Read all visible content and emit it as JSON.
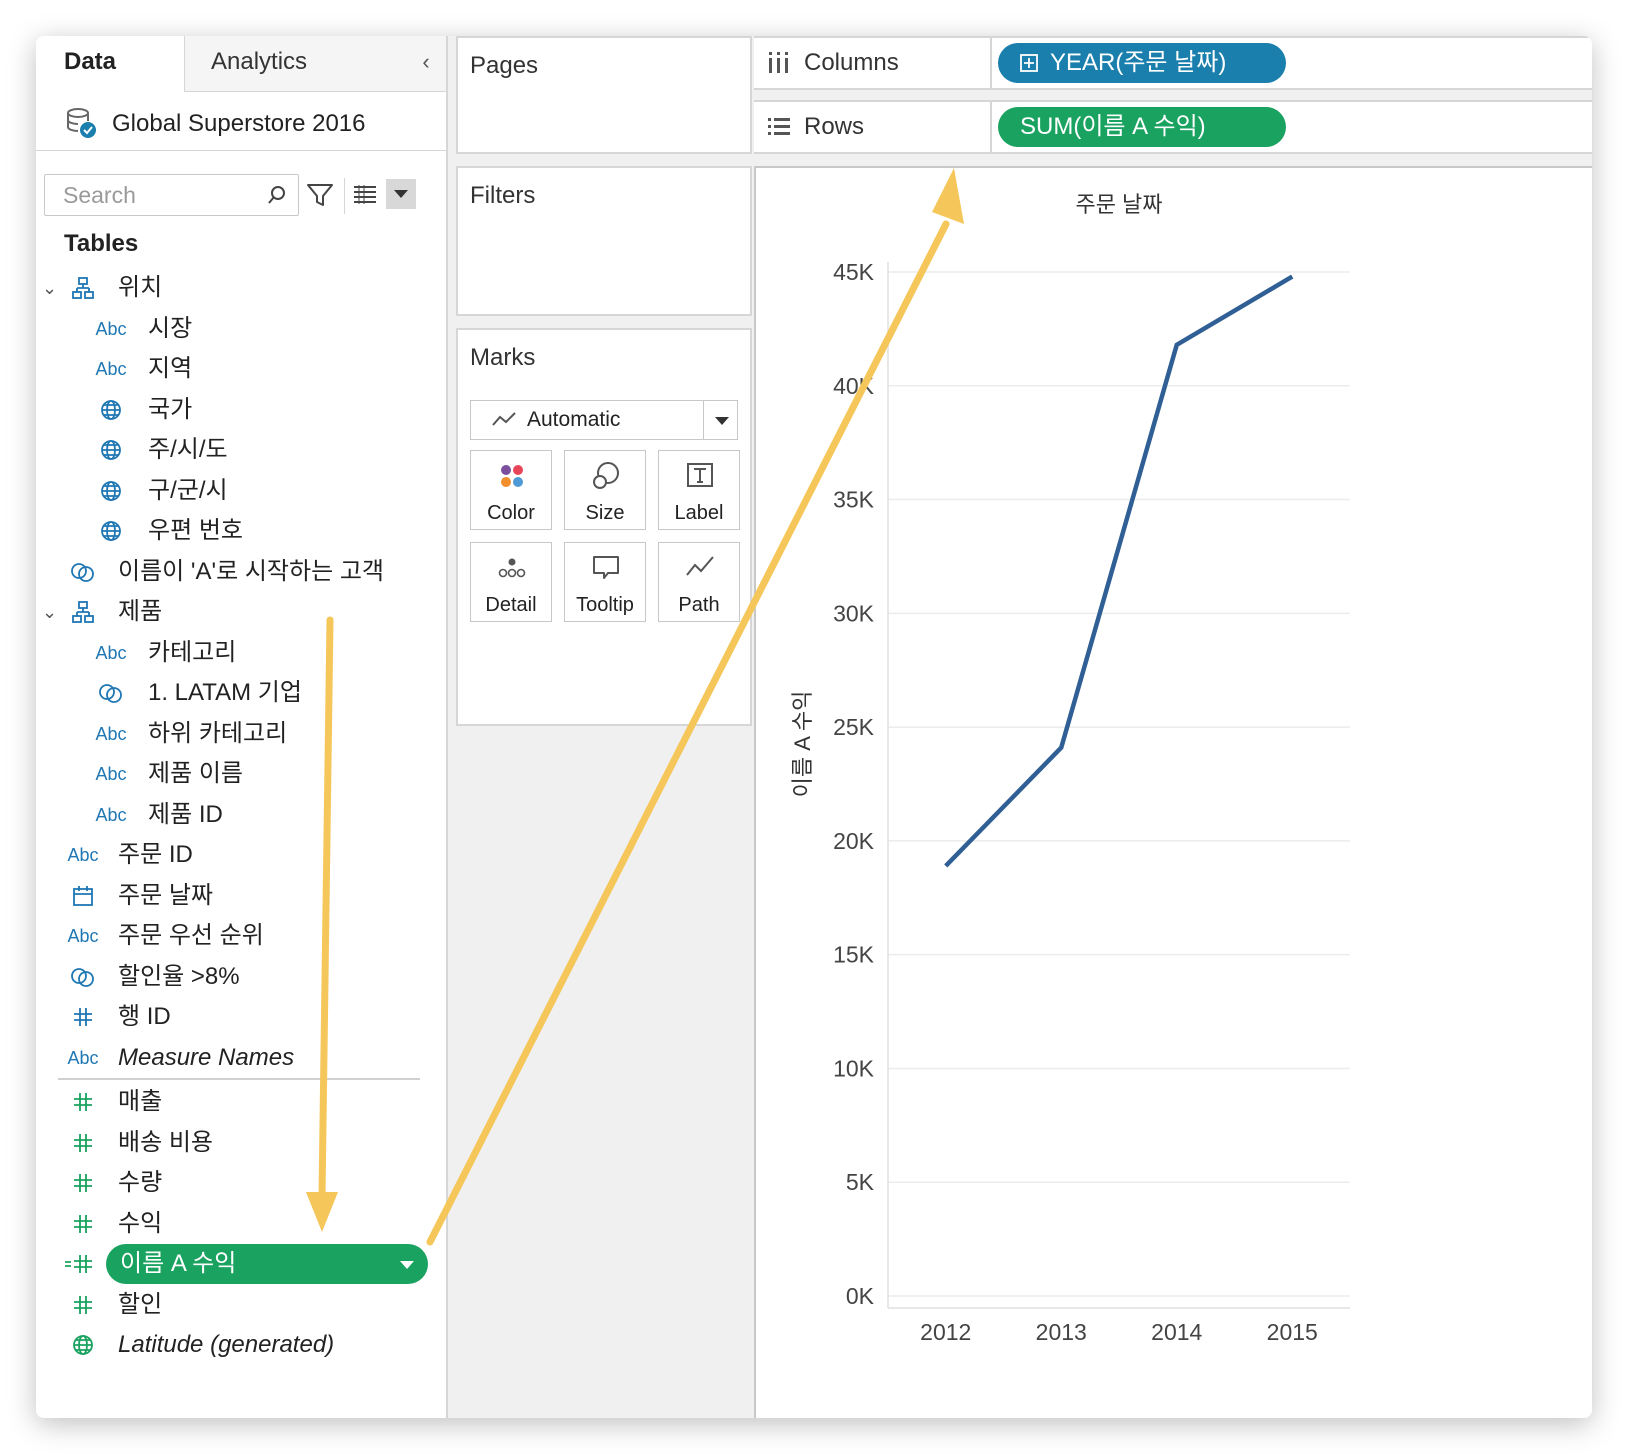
{
  "data_pane": {
    "tabs": [
      "Data",
      "Analytics"
    ],
    "datasource": "Global Superstore 2016",
    "search_placeholder": "Search",
    "tables_header": "Tables",
    "fields": [
      {
        "label": "위치",
        "icon": "hierarchy-icon",
        "level": 0,
        "expandable": true
      },
      {
        "label": "시장",
        "icon": "Abc",
        "level": 1
      },
      {
        "label": "지역",
        "icon": "Abc",
        "level": 1
      },
      {
        "label": "국가",
        "icon": "globe-icon",
        "level": 1
      },
      {
        "label": "주/시/도",
        "icon": "globe-icon",
        "level": 1
      },
      {
        "label": "구/군/시",
        "icon": "globe-icon",
        "level": 1
      },
      {
        "label": "우편 번호",
        "icon": "globe-icon",
        "level": 1
      },
      {
        "label": "이름이 'A'로 시작하는 고객",
        "icon": "set-icon",
        "level": 0
      },
      {
        "label": "제품",
        "icon": "hierarchy-icon",
        "level": 0,
        "expandable": true
      },
      {
        "label": "카테고리",
        "icon": "Abc",
        "level": 1
      },
      {
        "label": "1. LATAM 기업",
        "icon": "set-icon",
        "level": 1
      },
      {
        "label": "하위 카테고리",
        "icon": "Abc",
        "level": 1
      },
      {
        "label": "제품 이름",
        "icon": "Abc",
        "level": 1
      },
      {
        "label": "제품 ID",
        "icon": "Abc",
        "level": 1
      },
      {
        "label": "주문 ID",
        "icon": "Abc",
        "level": 0
      },
      {
        "label": "주문 날짜",
        "icon": "calendar-icon",
        "level": 0
      },
      {
        "label": "주문 우선 순위",
        "icon": "Abc",
        "level": 0
      },
      {
        "label": "할인율 >8%",
        "icon": "set-icon",
        "level": 0
      },
      {
        "label": "행 ID",
        "icon": "number-icon",
        "level": 0
      },
      {
        "label": "Measure Names",
        "icon": "Abc",
        "level": 0,
        "italic": true
      }
    ],
    "measures": [
      {
        "label": "매출",
        "icon": "number-icon"
      },
      {
        "label": "배송 비용",
        "icon": "number-icon"
      },
      {
        "label": "수량",
        "icon": "number-icon"
      },
      {
        "label": "수익",
        "icon": "number-icon"
      },
      {
        "label": "이름 A 수익",
        "icon": "calc-number-icon",
        "selected": true
      },
      {
        "label": "할인",
        "icon": "number-icon"
      },
      {
        "label": "Latitude (generated)",
        "icon": "globe-icon",
        "italic": true
      }
    ]
  },
  "cards": {
    "pages": "Pages",
    "filters": "Filters",
    "marks": "Marks",
    "mark_type": "Automatic",
    "mark_buttons": [
      "Color",
      "Size",
      "Label",
      "Detail",
      "Tooltip",
      "Path"
    ]
  },
  "shelves": {
    "columns_label": "Columns",
    "columns_pill": "YEAR(주문 날짜)",
    "rows_label": "Rows",
    "rows_pill": "SUM(이름 A 수익)"
  },
  "colors": {
    "line": "#2f5f94",
    "pill_blue": "#1b7fad",
    "pill_green": "#1aa260",
    "annotation_arrow": "#f5c659"
  },
  "chart_data": {
    "type": "line",
    "title": "주문 날짜",
    "xlabel": "",
    "ylabel": "이름 A 수익",
    "categories": [
      "2012",
      "2013",
      "2014",
      "2015"
    ],
    "values": [
      18900,
      24100,
      41800,
      44800
    ],
    "ylim": [
      0,
      45000
    ],
    "yticks": [
      "0K",
      "5K",
      "10K",
      "15K",
      "20K",
      "25K",
      "30K",
      "35K",
      "40K",
      "45K"
    ],
    "grid": true
  }
}
